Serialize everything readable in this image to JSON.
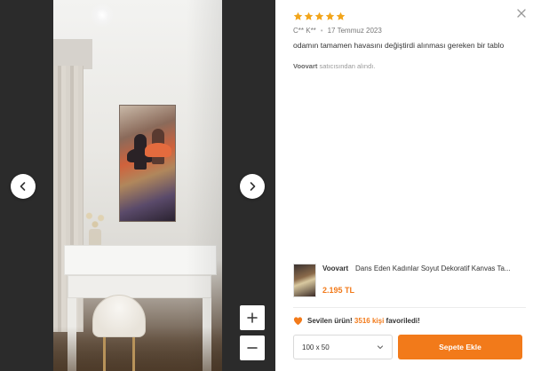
{
  "review": {
    "rating": 5,
    "author": "C** K**",
    "date": "17 Temmuz 2023",
    "comment": "odamın tamamen havasını değiştirdi alınması gereken bir tablo",
    "seller": "Voovart",
    "seller_suffix": "satıcısından alındı."
  },
  "product": {
    "brand": "Voovart",
    "name": "Dans Eden Kadınlar Soyut Dekoratif Kanvas Ta...",
    "price": "2.195 TL"
  },
  "favorites": {
    "prefix": "Sevilen ürün!",
    "count_text": "3516 kişi",
    "suffix": "favoriledi!"
  },
  "actions": {
    "size_selected": "100 x 50",
    "add_to_cart": "Sepete Ekle"
  },
  "colors": {
    "accent": "#f27a1a",
    "star": "#f2a51a",
    "viewer_bg": "#2b2b2b"
  },
  "icons": {
    "prev": "chevron-left-icon",
    "next": "chevron-right-icon",
    "zoom_in": "plus-icon",
    "zoom_out": "minus-icon",
    "close": "close-icon",
    "star": "star-icon",
    "heart": "heart-icon",
    "dropdown": "chevron-down-icon"
  }
}
